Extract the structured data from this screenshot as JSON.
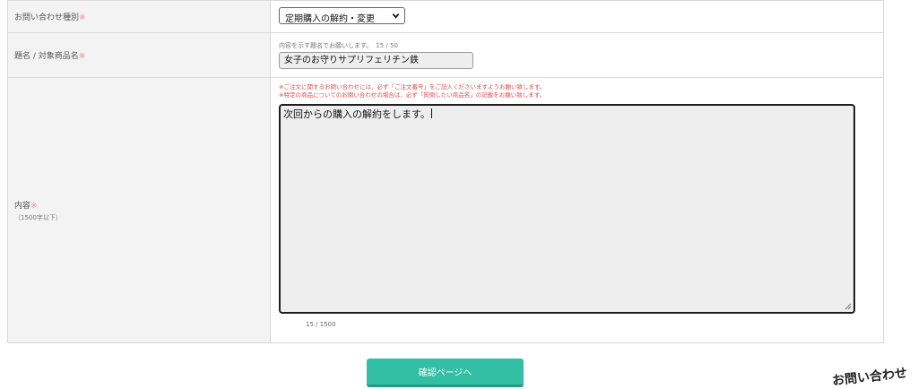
{
  "form": {
    "required_mark": "※",
    "inquiry_type": {
      "label": "お問い合わせ種別",
      "selected": "定期購入の解約・変更"
    },
    "subject": {
      "label": "題名 / 対象商品名",
      "hint": "内容を示す題名でお願いします。",
      "count": "15 / 50",
      "value": "女子のお守りサプリフェリチン鉄"
    },
    "content": {
      "label": "内容",
      "label_sub": "（1500字以下）",
      "notes": [
        "※ご注文に関するお問い合わせには、必ず「ご注文番号」をご記入くださいますようお願い致します。",
        "※特定の商品についてのお問い合わせの場合は、必ず「質問したい商品名」の記載をお願い致します。"
      ],
      "value": "次回からの購入の解約をします。",
      "count": "15 / 1500"
    }
  },
  "confirm_button": {
    "label": "確認ページへ"
  },
  "corner_text": "お問い合わせ",
  "colors": {
    "required": "#f08c8c",
    "note": "#e24b4b",
    "button": "#33bfa3",
    "label_bg": "#f3f3f3"
  }
}
